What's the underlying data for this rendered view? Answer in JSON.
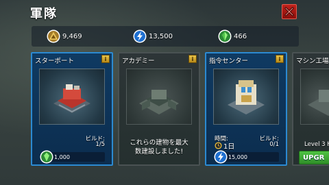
{
  "header": {
    "title": "軍隊"
  },
  "resources": [
    {
      "icon": "gold-triangle-icon",
      "amount": "9,469"
    },
    {
      "icon": "lightning-energy-icon",
      "amount": "13,500"
    },
    {
      "icon": "green-crystal-icon",
      "amount": "466"
    }
  ],
  "cards": [
    {
      "title": "スターポート",
      "info": "i",
      "build_label": "ビルド:",
      "build_count": "1/5",
      "cost": "1,000"
    },
    {
      "title": "アカデミー",
      "info": "i",
      "maxed_text": "これらの建物を最大\n数建設しました!"
    },
    {
      "title": "指令センター",
      "info": "i",
      "time_label": "時間:",
      "time_value": "1日",
      "build_label": "ビルド:",
      "build_count": "0/1",
      "cost": "15,000"
    },
    {
      "title": "マシン工場",
      "info": "i",
      "level_text": "Level 3 H",
      "upgrade_label": "UPGR"
    }
  ],
  "colors": {
    "accent_blue": "#2b8ad2",
    "upgrade_green": "#3aa932",
    "close_red": "#c0221b"
  }
}
